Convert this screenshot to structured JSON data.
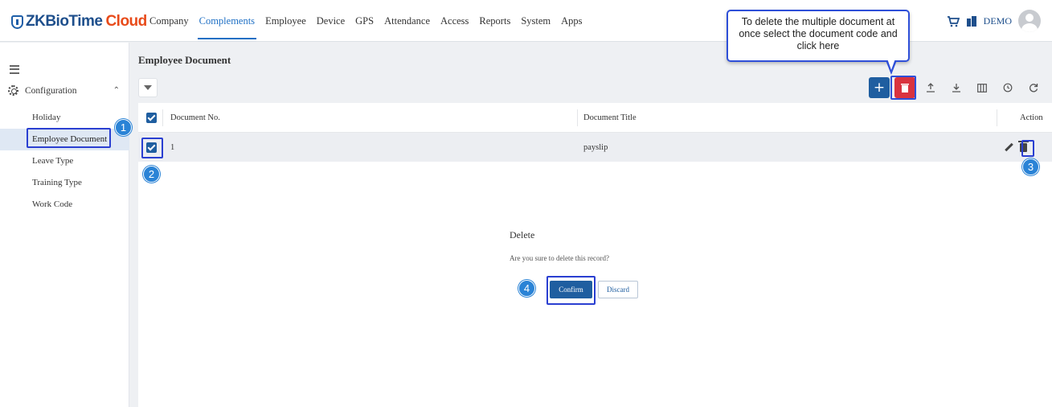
{
  "app": {
    "logo_zk": "ZKBioTime",
    "logo_cloud": "Cloud"
  },
  "nav": {
    "items": [
      "Company",
      "Complements",
      "Employee",
      "Device",
      "GPS",
      "Attendance",
      "Access",
      "Reports",
      "System",
      "Apps"
    ],
    "active": "Complements"
  },
  "header": {
    "user": "DEMO"
  },
  "sidebar": {
    "section": "Configuration",
    "items": [
      {
        "label": "Holiday"
      },
      {
        "label": "Employee Document"
      },
      {
        "label": "Leave Type"
      },
      {
        "label": "Training Type"
      },
      {
        "label": "Work Code"
      }
    ],
    "active_index": 1
  },
  "page": {
    "title": "Employee Document"
  },
  "table": {
    "columns": [
      "Document No.",
      "Document Title",
      "Action"
    ],
    "rows": [
      {
        "doc_no": "1",
        "title": "payslip",
        "selected": true
      }
    ]
  },
  "dialog": {
    "title": "Delete",
    "message": "Are you sure to delete this record?",
    "confirm": "Confirm",
    "discard": "Discard"
  },
  "callout": {
    "text": "To delete the multiple document at once select the document code and click here"
  },
  "badges": [
    "1",
    "2",
    "3",
    "4"
  ],
  "colors": {
    "primary": "#1f5ea0",
    "danger": "#d9333f",
    "highlight": "#2a3fd1",
    "badge": "#2a83d6",
    "brand_orange": "#e84b1a"
  }
}
